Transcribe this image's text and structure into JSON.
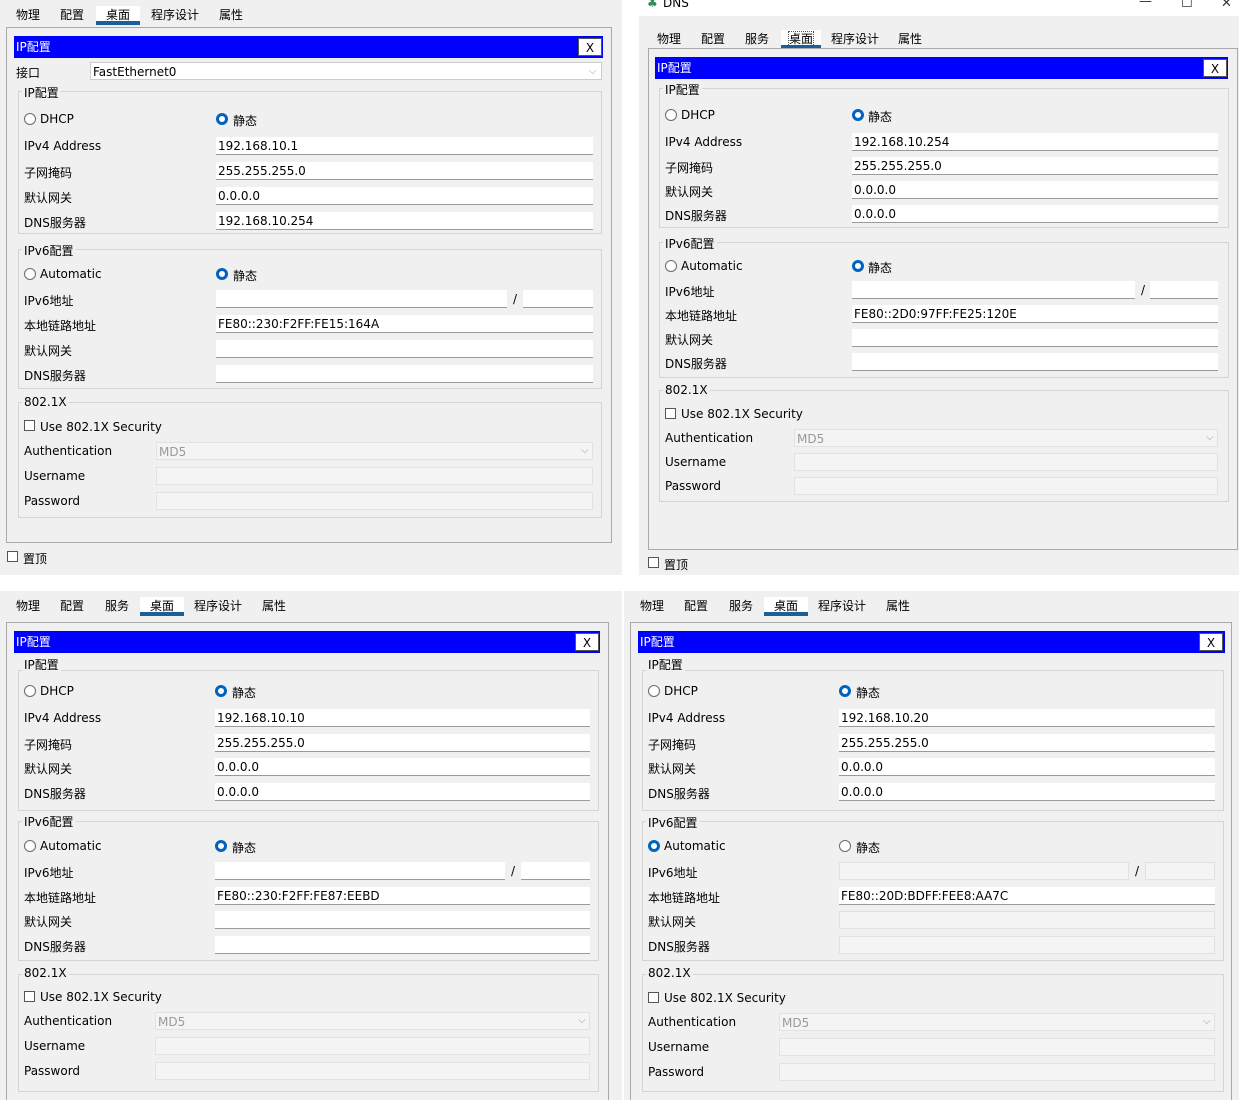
{
  "common": {
    "dialog_title": "IP配置",
    "close": "X",
    "ipv4_section": "IP配置",
    "ipv6_section": "IPv6配置",
    "dot1x_section": "802.1X",
    "dhcp": "DHCP",
    "static": "静态",
    "automatic": "Automatic",
    "ipv4_address": "IPv4 Address",
    "subnet_mask": "子网掩码",
    "default_gateway": "默认网关",
    "dns_server": "DNS服务器",
    "ipv6_address": "IPv6地址",
    "link_local": "本地链路地址",
    "use_8021x": "Use 802.1X Security",
    "authentication": "Authentication",
    "username": "Username",
    "password": "Password",
    "md5": "MD5",
    "slash": "/",
    "interface": "接口",
    "pin_top": "置顶"
  },
  "window_dns": {
    "title": "DNS",
    "min": "—",
    "max": "☐",
    "close": "✕"
  },
  "panels": [
    {
      "tabs": [
        "物理",
        "配置",
        "桌面",
        "程序设计",
        "属性"
      ],
      "active_tab": 2,
      "interface_value": "FastEthernet0",
      "ipv4_mode": "static",
      "ipv4": "192.168.10.1",
      "mask": "255.255.255.0",
      "gateway": "0.0.0.0",
      "dns": "192.168.10.254",
      "ipv6_mode": "static",
      "ipv6": "",
      "prefix": "",
      "link_local": "FE80::230:F2FF:FE15:164A",
      "gw6": "",
      "dns6": ""
    },
    {
      "tabs": [
        "物理",
        "配置",
        "服务",
        "桌面",
        "程序设计",
        "属性"
      ],
      "active_tab": 3,
      "ipv4_mode": "static",
      "ipv4": "192.168.10.254",
      "mask": "255.255.255.0",
      "gateway": "0.0.0.0",
      "dns": "0.0.0.0",
      "ipv6_mode": "static",
      "ipv6": "",
      "prefix": "",
      "link_local": "FE80::2D0:97FF:FE25:120E",
      "gw6": "",
      "dns6": ""
    },
    {
      "tabs": [
        "物理",
        "配置",
        "服务",
        "桌面",
        "程序设计",
        "属性"
      ],
      "active_tab": 3,
      "ipv4_mode": "static",
      "ipv4": "192.168.10.10",
      "mask": "255.255.255.0",
      "gateway": "0.0.0.0",
      "dns": "0.0.0.0",
      "ipv6_mode": "static",
      "ipv6": "",
      "prefix": "",
      "link_local": "FE80::230:F2FF:FE87:EEBD",
      "gw6": "",
      "dns6": ""
    },
    {
      "tabs": [
        "物理",
        "配置",
        "服务",
        "桌面",
        "程序设计",
        "属性"
      ],
      "active_tab": 3,
      "ipv4_mode": "static",
      "ipv4": "192.168.10.20",
      "mask": "255.255.255.0",
      "gateway": "0.0.0.0",
      "dns": "0.0.0.0",
      "ipv6_mode": "automatic",
      "ipv6": "",
      "prefix": "",
      "link_local": "FE80::20D:BDFF:FEE8:AA7C",
      "gw6": "",
      "dns6": ""
    }
  ]
}
